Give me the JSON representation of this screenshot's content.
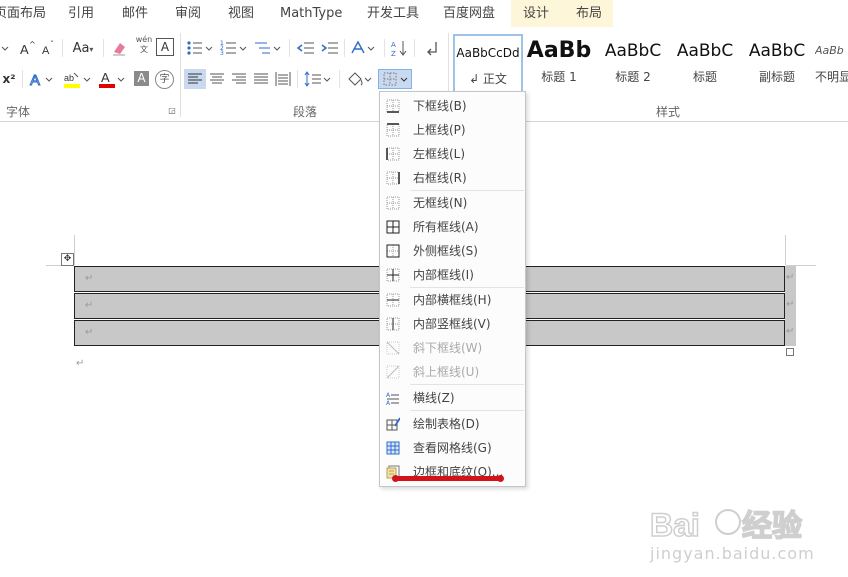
{
  "tabs": [
    "页面布局",
    "引用",
    "邮件",
    "审阅",
    "视图",
    "MathType",
    "开发工具",
    "百度网盘",
    "设计",
    "布局"
  ],
  "groups": {
    "font": "字体",
    "paragraph": "段落",
    "styles": "样式"
  },
  "font_buttons": {
    "case": "Aa",
    "superscript": "x²",
    "phonetic": "wén 文",
    "char_border": "A",
    "char_shading": "A",
    "enclose": "字"
  },
  "styles": [
    {
      "sample": "AaBbCcDd",
      "name": "↲ 正文"
    },
    {
      "sample": "AaBb",
      "name": "标题 1"
    },
    {
      "sample": "AaBbC",
      "name": "标题 2"
    },
    {
      "sample": "AaBbC",
      "name": "标题"
    },
    {
      "sample": "AaBbC",
      "name": "副标题"
    },
    {
      "sample": "AaBb",
      "name": "不明显"
    }
  ],
  "borders_menu": [
    {
      "label": "下框线(B)",
      "icon": "bottom-border-icon",
      "disabled": false
    },
    {
      "label": "上框线(P)",
      "icon": "top-border-icon",
      "disabled": false
    },
    {
      "label": "左框线(L)",
      "icon": "left-border-icon",
      "disabled": false
    },
    {
      "label": "右框线(R)",
      "icon": "right-border-icon",
      "disabled": false
    },
    {
      "label": "无框线(N)",
      "icon": "no-border-icon",
      "disabled": false
    },
    {
      "label": "所有框线(A)",
      "icon": "all-borders-icon",
      "disabled": false
    },
    {
      "label": "外侧框线(S)",
      "icon": "outside-borders-icon",
      "disabled": false
    },
    {
      "label": "内部框线(I)",
      "icon": "inside-borders-icon",
      "disabled": false
    },
    {
      "label": "内部横框线(H)",
      "icon": "inside-horizontal-border-icon",
      "disabled": false
    },
    {
      "label": "内部竖框线(V)",
      "icon": "inside-vertical-border-icon",
      "disabled": false
    },
    {
      "label": "斜下框线(W)",
      "icon": "diagonal-down-border-icon",
      "disabled": true
    },
    {
      "label": "斜上框线(U)",
      "icon": "diagonal-up-border-icon",
      "disabled": true
    },
    {
      "label": "横线(Z)",
      "icon": "horizontal-line-icon",
      "disabled": false
    },
    {
      "label": "绘制表格(D)",
      "icon": "draw-table-icon",
      "disabled": false
    },
    {
      "label": "查看网格线(G)",
      "icon": "view-gridlines-icon",
      "disabled": false
    },
    {
      "label": "边框和底纹(O)...",
      "icon": "borders-shading-icon",
      "disabled": false
    }
  ],
  "document": {
    "paragraph_mark": "↵"
  },
  "watermark": {
    "brand": "Bai du 经验",
    "url": "jingyan.baidu.com"
  },
  "colors": {
    "highlight": "#ffff00",
    "font_color": "#e00000",
    "annotation": "#d0141a",
    "table_fill": "#c8c8c8",
    "context_tab": "#fdf6d9"
  }
}
